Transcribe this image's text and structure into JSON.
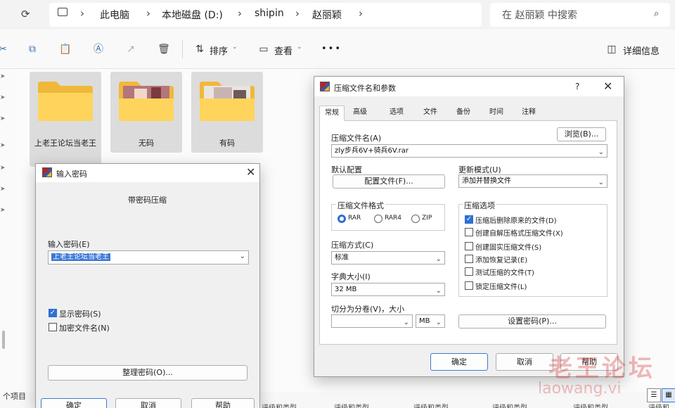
{
  "explorer": {
    "breadcrumb": [
      "此电脑",
      "本地磁盘 (D:)",
      "shipin",
      "赵丽颖"
    ],
    "search_placeholder": "在 赵丽颖 中搜索",
    "toolbar": {
      "sort_label": "排序",
      "view_label": "查看",
      "more": "•••",
      "details_label": "详细信息"
    },
    "folders": [
      {
        "name": "上老王论坛当老王",
        "has_preview": false
      },
      {
        "name": "无码",
        "has_preview": true
      },
      {
        "name": "有码",
        "has_preview": true
      }
    ],
    "status_text": "个项目",
    "bottom_peek_text": "评级和类型"
  },
  "password_dialog": {
    "title": "输入密码",
    "heading": "带密码压缩",
    "input_label": "输入密码(E)",
    "password_value": "上老王论坛当老王",
    "show_password_label": "显示密码(S)",
    "show_password_checked": true,
    "encrypt_names_label": "加密文件名(N)",
    "encrypt_names_checked": false,
    "organize_button": "整理密码(O)...",
    "ok_button": "确定",
    "cancel_button": "取消",
    "help_button": "帮助"
  },
  "archive_dialog": {
    "title": "压缩文件名和参数",
    "help_glyph": "?",
    "tabs": [
      "常规",
      "高级",
      "选项",
      "文件",
      "备份",
      "时间",
      "注释"
    ],
    "active_tab": "常规",
    "archive_name_label": "压缩文件名(A)",
    "browse_button": "浏览(B)...",
    "archive_name_value": "zly步兵6V+骑兵6V.rar",
    "default_profile_label": "默认配置",
    "profile_button": "配置文件(F)...",
    "update_mode_label": "更新模式(U)",
    "update_mode_value": "添加并替换文件",
    "format_group_label": "压缩文件格式",
    "formats": [
      "RAR",
      "RAR4",
      "ZIP"
    ],
    "selected_format": "RAR",
    "options_group_label": "压缩选项",
    "options": [
      {
        "label": "压缩后删除原来的文件(D)",
        "checked": true
      },
      {
        "label": "创建自解压格式压缩文件(X)",
        "checked": false
      },
      {
        "label": "创建固实压缩文件(S)",
        "checked": false
      },
      {
        "label": "添加恢复记录(E)",
        "checked": false
      },
      {
        "label": "测试压缩的文件(T)",
        "checked": false
      },
      {
        "label": "锁定压缩文件(L)",
        "checked": false
      }
    ],
    "method_label": "压缩方式(C)",
    "method_value": "标准",
    "dict_label": "字典大小(I)",
    "dict_value": "32 MB",
    "split_label": "切分为分卷(V)，大小",
    "split_value": "",
    "split_unit": "MB",
    "set_password_button": "设置密码(P)...",
    "ok_button": "确定",
    "cancel_button": "取消",
    "help_button": "帮助"
  },
  "watermark": {
    "line1": "老王论坛",
    "line2": "laowang.vi"
  }
}
